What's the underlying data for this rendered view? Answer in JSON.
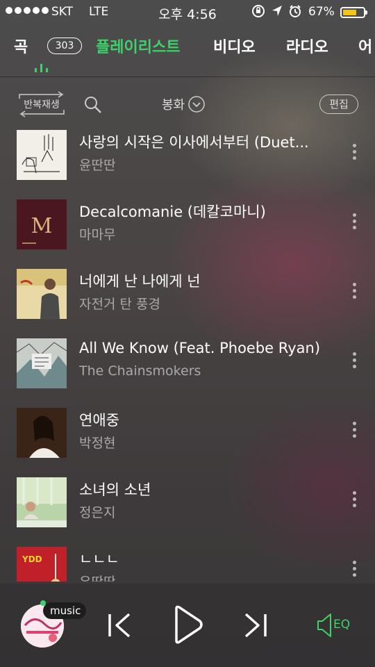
{
  "status": {
    "carrier": "SKT",
    "network": "LTE",
    "time": "오후 4:56",
    "battery": "67%",
    "battery_level": 0.67
  },
  "tabs": [
    {
      "label": "곡",
      "count": "303"
    },
    {
      "label": "플레이리스트"
    },
    {
      "label": "비디오"
    },
    {
      "label": "라디오"
    },
    {
      "label": "어"
    }
  ],
  "toolbar": {
    "repeat_label": "반복재생",
    "sort_label": "봉화",
    "edit_label": "편집"
  },
  "songs": [
    {
      "title": "사랑의 시작은 이사에서부터 (Duet...",
      "artist": "윤딴딴"
    },
    {
      "title": "Decalcomanie (데칼코마니)",
      "artist": "마마무"
    },
    {
      "title": "너에게 난 나에게 넌",
      "artist": "자전거 탄 풍경"
    },
    {
      "title": "All We Know (Feat. Phoebe Ryan)",
      "artist": "The Chainsmokers"
    },
    {
      "title": "연애중",
      "artist": "박정현"
    },
    {
      "title": "소녀의 소년",
      "artist": "정은지"
    },
    {
      "title": "ㄴㄴㄴ",
      "artist": "유딴딴"
    }
  ],
  "player": {
    "badge": "music",
    "eq_label": "EQ"
  },
  "colors": {
    "accent": "#3dd26a",
    "battery": "#f5c518"
  },
  "icons": [
    "search-icon",
    "chevron-down-icon",
    "more-icon",
    "previous-icon",
    "play-icon",
    "next-icon",
    "eq-speaker-icon",
    "location-icon",
    "alarm-icon",
    "rotation-lock-icon"
  ]
}
